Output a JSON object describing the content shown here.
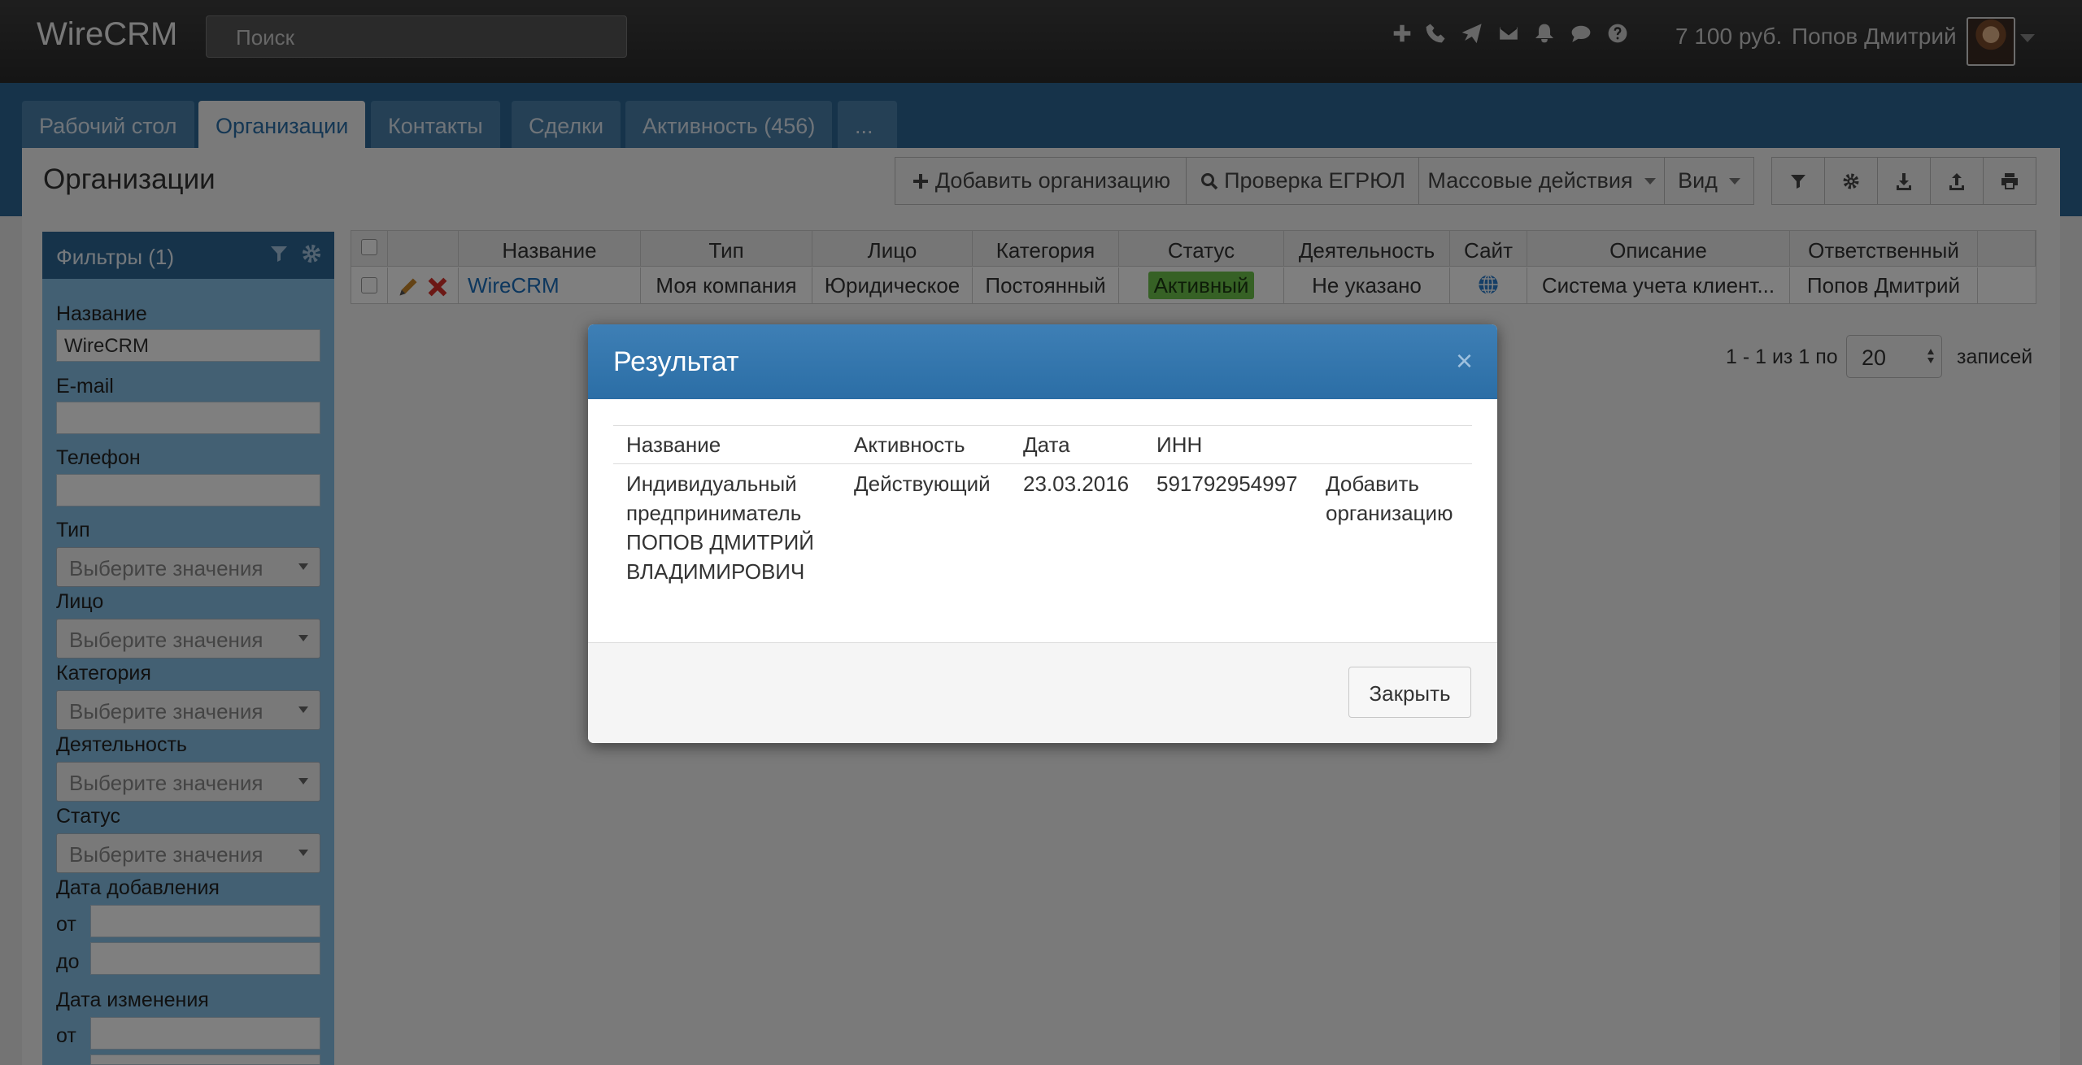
{
  "app": {
    "brand": "WireCRM",
    "search_placeholder": "Поиск",
    "balance": "7 100 руб.",
    "user": "Попов Дмитрий"
  },
  "tabs": [
    {
      "label": "Рабочий стол"
    },
    {
      "label": "Организации"
    },
    {
      "label": "Контакты"
    },
    {
      "label": "Сделки"
    },
    {
      "label": "Активность (456)"
    },
    {
      "label": "..."
    }
  ],
  "page": {
    "title": "Организации",
    "add_button": "Добавить организацию",
    "check_button": "Проверка ЕГРЮЛ",
    "mass_actions": "Массовые действия",
    "view": "Вид"
  },
  "filters": {
    "header": "Фильтры (1)",
    "name_label": "Название",
    "name_value": "WireCRM",
    "email_label": "E-mail",
    "phone_label": "Телефон",
    "type_label": "Тип",
    "face_label": "Лицо",
    "category_label": "Категория",
    "activity_label": "Деятельность",
    "status_label": "Статус",
    "select_placeholder": "Выберите значения",
    "added_label": "Дата добавления",
    "changed_label": "Дата изменения",
    "from": "от",
    "to": "до"
  },
  "table": {
    "headers": [
      "Название",
      "Тип",
      "Лицо",
      "Категория",
      "Статус",
      "Деятельность",
      "Сайт",
      "Описание",
      "Ответственный"
    ],
    "row": {
      "name": "WireCRM",
      "type": "Моя компания",
      "face": "Юридическое",
      "category": "Постоянный",
      "status": "Активный",
      "activity": "Не указано",
      "description": "Система учета клиент...",
      "responsible": "Попов Дмитрий"
    },
    "pager": "1 - 1 из 1 по",
    "per_page": "20",
    "records": "записей"
  },
  "modal": {
    "title": "Результат",
    "close_x": "×",
    "headers": {
      "name": "Название",
      "activity": "Активность",
      "date": "Дата",
      "inn": "ИНН"
    },
    "row": {
      "name": [
        "Индивидуальный",
        "предприниматель",
        "ПОПОВ ДМИТРИЙ",
        "ВЛАДИМИРОВИЧ"
      ],
      "activity": "Действующий",
      "date": "23.03.2016",
      "inn": "591792954997",
      "action": [
        "Добавить",
        "организацию"
      ]
    },
    "close_button": "Закрыть"
  },
  "colors": {
    "navbar": "#2f2f2f",
    "tabstrip": "#2d6795",
    "filters_panel": "#86c0e6",
    "modal_header": "#3476ad",
    "status_active": "#6cc24a",
    "link": "#1a6fbd"
  },
  "icons": [
    "plus-icon",
    "phone-icon",
    "send-icon",
    "mail-icon",
    "bell-icon",
    "chat-icon",
    "help-icon",
    "filter-icon",
    "gear-icon",
    "download-icon",
    "upload-icon",
    "print-icon",
    "search-icon",
    "edit-icon",
    "delete-icon",
    "globe-icon"
  ]
}
